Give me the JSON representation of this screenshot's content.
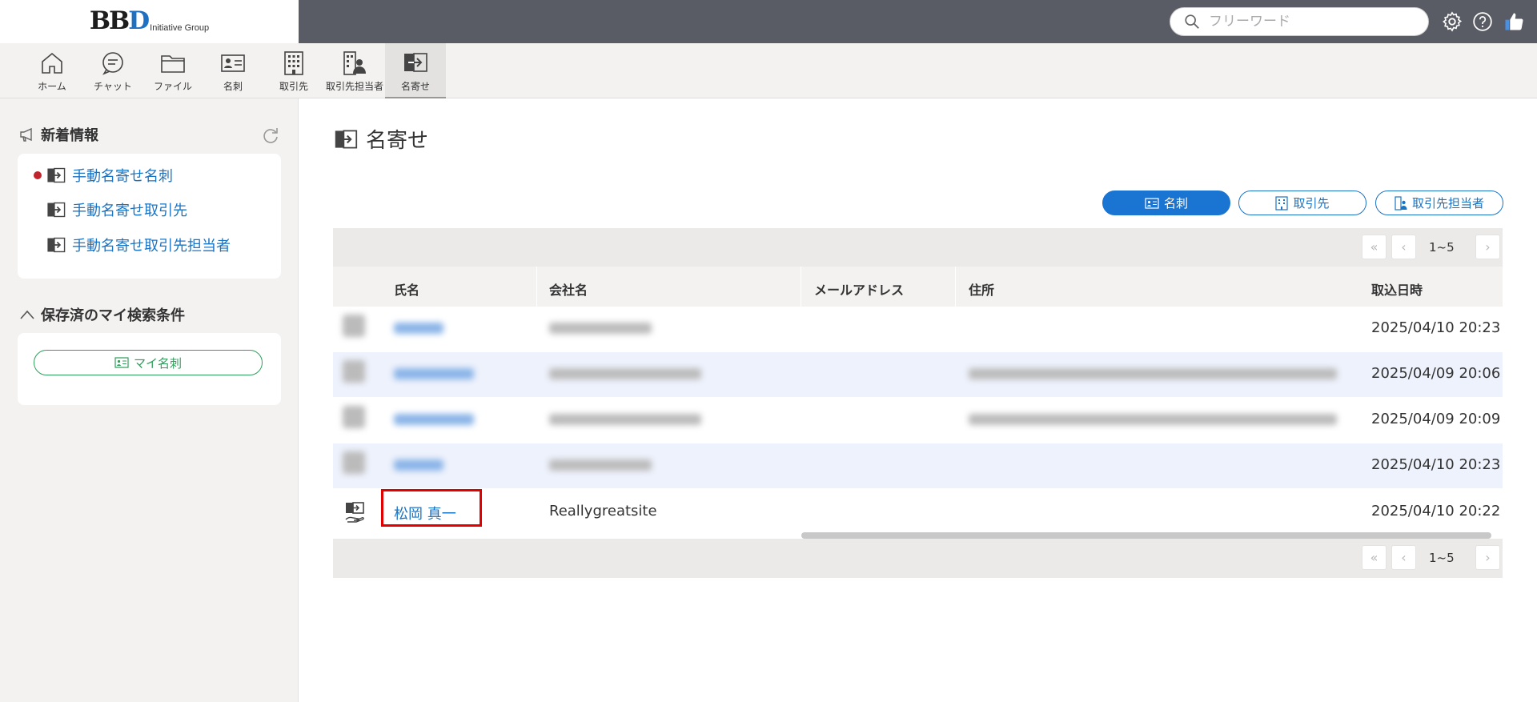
{
  "header": {
    "logo_main": "BBD",
    "logo_sub": "Initiative Group",
    "search_placeholder": "フリーワード"
  },
  "nav": {
    "items": [
      {
        "label": "ホーム",
        "icon": "home-icon"
      },
      {
        "label": "チャット",
        "icon": "chat-icon"
      },
      {
        "label": "ファイル",
        "icon": "folder-icon"
      },
      {
        "label": "名刺",
        "icon": "business-card-icon"
      },
      {
        "label": "取引先",
        "icon": "building-icon"
      },
      {
        "label": "取引先担当者",
        "icon": "contact-person-icon"
      },
      {
        "label": "名寄せ",
        "icon": "merge-icon",
        "active": true
      }
    ]
  },
  "sidebar": {
    "news_title": "新着情報",
    "news_items": [
      {
        "label": "手動名寄せ名刺",
        "unread": true
      },
      {
        "label": "手動名寄せ取引先",
        "unread": false
      },
      {
        "label": "手動名寄せ取引先担当者",
        "unread": false
      }
    ],
    "saved_title": "保存済のマイ検索条件",
    "my_card_button": "マイ名刺"
  },
  "main": {
    "title": "名寄せ",
    "filters": [
      {
        "label": "名刺",
        "active": true
      },
      {
        "label": "取引先",
        "active": false
      },
      {
        "label": "取引先担当者",
        "active": false
      }
    ],
    "pager_text": "1~5",
    "columns": [
      "氏名",
      "会社名",
      "メールアドレス",
      "住所",
      "取込日時"
    ],
    "rows": [
      {
        "name": "",
        "company": "",
        "address": "",
        "date": "2025/04/10 20:23",
        "blurred": true
      },
      {
        "name": "",
        "company": "",
        "address": "",
        "date": "2025/04/09 20:06",
        "blurred": true
      },
      {
        "name": "",
        "company": "",
        "address": "",
        "date": "2025/04/09 20:09",
        "blurred": true
      },
      {
        "name": "",
        "company": "",
        "address": "",
        "date": "2025/04/10 20:23",
        "blurred": true
      },
      {
        "name": "松岡 真一",
        "company": "Reallygreatsite",
        "address": "",
        "date": "2025/04/10 20:22",
        "blurred": false,
        "highlighted": true
      }
    ]
  },
  "colors": {
    "accent_blue": "#1a74d2",
    "link_blue": "#1a74c4",
    "green": "#2e9e5b",
    "highlight_red": "#e30000",
    "topbar": "#5a5c65"
  }
}
